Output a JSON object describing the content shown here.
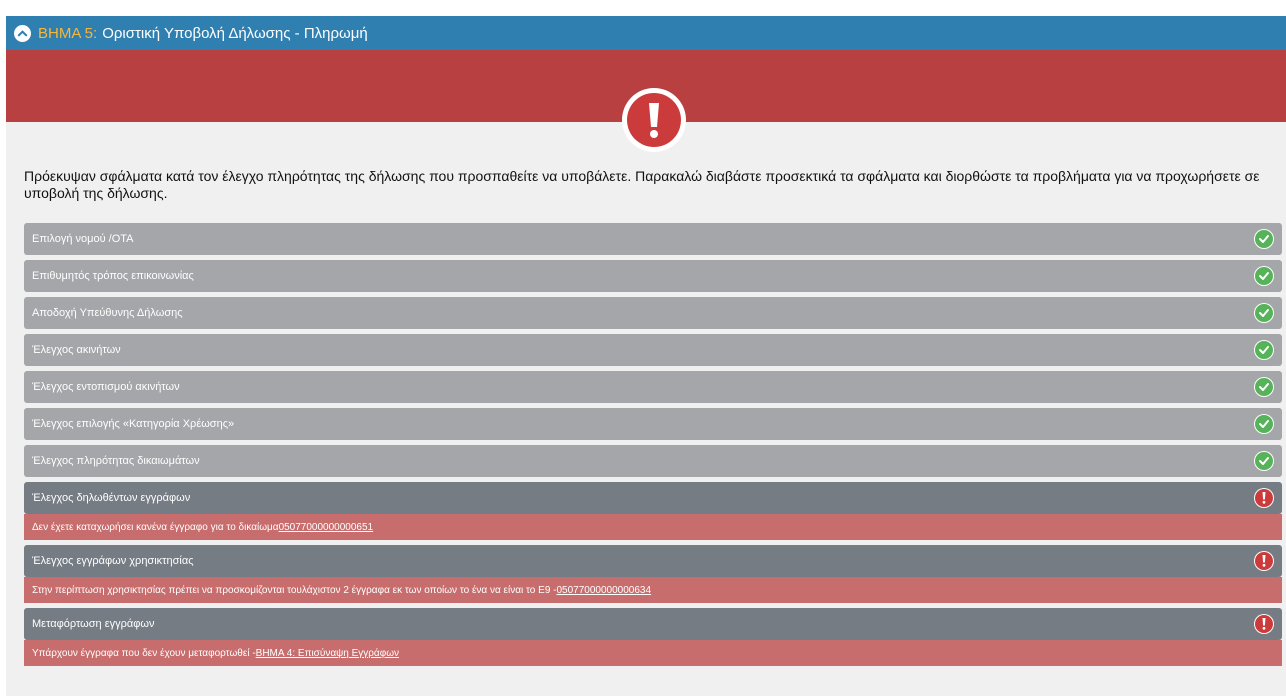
{
  "header": {
    "step_label": "ΒΗΜΑ 5:",
    "title": "Οριστική Υποβολή Δήλωσης - Πληρωμή"
  },
  "intro_text": "Πρόεκυψαν σφάλματα κατά τον έλεγχο πληρότητας της δήλωσης που προσπαθείτε να υποβάλετε. Παρακαλώ διαβάστε προσεκτικά τα σφάλματα και διορθώστε τα προβλήματα για να προχωρήσετε σε υποβολή της δήλωσης.",
  "checks": [
    {
      "label": "Επιλογή νομού /ΟΤΑ",
      "status": "ok"
    },
    {
      "label": "Επιθυμητός τρόπος επικοινωνίας",
      "status": "ok"
    },
    {
      "label": "Αποδοχή Υπεύθυνης Δήλωσης",
      "status": "ok"
    },
    {
      "label": "Έλεγχος ακινήτων",
      "status": "ok"
    },
    {
      "label": "Έλεγχος εντοπισμού ακινήτων",
      "status": "ok"
    },
    {
      "label": "Έλεγχος επιλογής «Κατηγορία Χρέωσης»",
      "status": "ok"
    },
    {
      "label": "Έλεγχος πληρότητας δικαιωμάτων",
      "status": "ok"
    },
    {
      "label": "Έλεγχος δηλωθέντων εγγράφων",
      "status": "error",
      "message": "Δεν έχετε καταχωρήσει κανένα έγγραφο για το δικαίωμα",
      "link": "05077000000000651"
    },
    {
      "label": "Έλεγχος εγγράφων χρησικτησίας",
      "status": "error",
      "message": "Στην περίπτωση χρησικτησίας πρέπει να προσκομίζονται τουλάχιστον 2 έγγραφα εκ των οποίων το ένα να είναι το Ε9 -",
      "link": "05077000000000634"
    },
    {
      "label": "Μεταφόρτωση εγγράφων",
      "status": "error",
      "message": "Υπάρχουν έγγραφα που δεν έχουν μεταφορτωθεί -",
      "link": "ΒΗΜΑ 4: Επισύναψη Εγγράφων"
    }
  ],
  "colors": {
    "header": "#2f7fb0",
    "banner": "#b94040",
    "ok_row": "#a4a6a9",
    "err_row": "#767c84",
    "err_msg": "#c86d6d",
    "ok_icon": "#56b35a",
    "err_icon": "#cc3b3b"
  }
}
